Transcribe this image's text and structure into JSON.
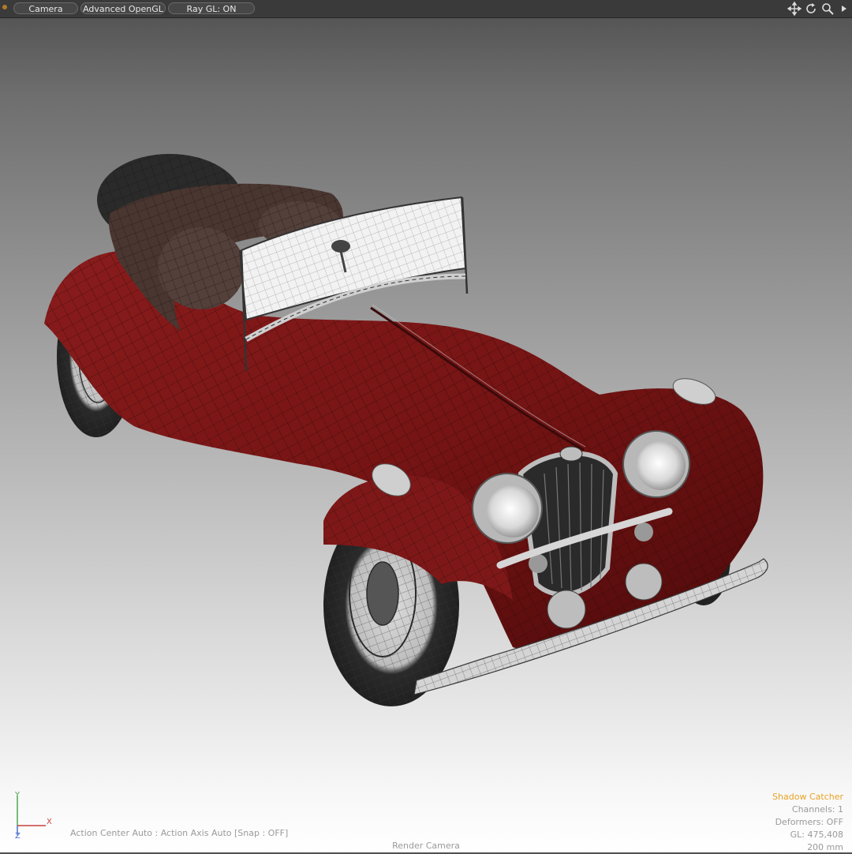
{
  "toolbar": {
    "buttons": [
      "Camera",
      "Advanced OpenGL",
      "Ray GL: ON"
    ],
    "icons": [
      "move-view-icon",
      "rotate-view-icon",
      "zoom-view-icon",
      "expand-arrow-icon"
    ]
  },
  "viewport": {
    "subject": "vintage roadster wireframe over shaded mesh",
    "colors": {
      "body": "#7a1414",
      "wire": "#2a0a0a",
      "interior": "#4a3630",
      "chrome": "#d8d8d8",
      "tire": "#262626"
    }
  },
  "axis": {
    "y": "Y",
    "x": "X",
    "z": "Z"
  },
  "status": {
    "action_center": "Action Center Auto : Action Axis Auto  [Snap : OFF]",
    "camera": "Render Camera"
  },
  "info": {
    "shadow_catcher": "Shadow Catcher",
    "channels": "Channels: 1",
    "deformers": "Deformers: OFF",
    "gl": "GL: 475,408",
    "focal": "200 mm"
  },
  "colors": {
    "accent": "#e7a326",
    "hud_text": "#9a9a9a",
    "toolbar_bg": "#3a3a3a"
  }
}
